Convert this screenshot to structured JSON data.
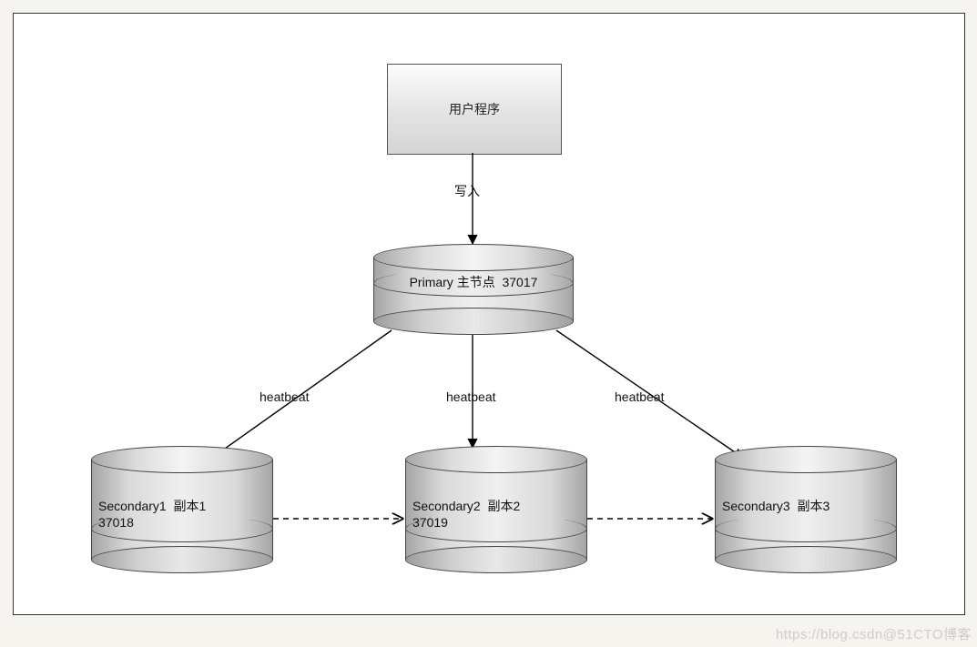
{
  "client": {
    "label": "用户程序"
  },
  "edges": {
    "write": {
      "label": "写入"
    },
    "hb_left": {
      "label": "heatbeat"
    },
    "hb_mid": {
      "label": "heatbeat"
    },
    "hb_right": {
      "label": "heatbeat"
    }
  },
  "nodes": {
    "primary": {
      "title": "Primary",
      "role": "主节点",
      "port": "37017",
      "label": "Primary 主节点  37017"
    },
    "sec1": {
      "title": "Secondary1",
      "role": "副本1",
      "port": "37018",
      "label": "Secondary1  副本1\n37018"
    },
    "sec2": {
      "title": "Secondary2",
      "role": "副本2",
      "port": "37019",
      "label": "Secondary2  副本2\n37019"
    },
    "sec3": {
      "title": "Secondary3",
      "role": "副本3",
      "port": "",
      "label": "Secondary3  副本3"
    }
  },
  "watermark": "https://blog.csdn@51CTO博客"
}
